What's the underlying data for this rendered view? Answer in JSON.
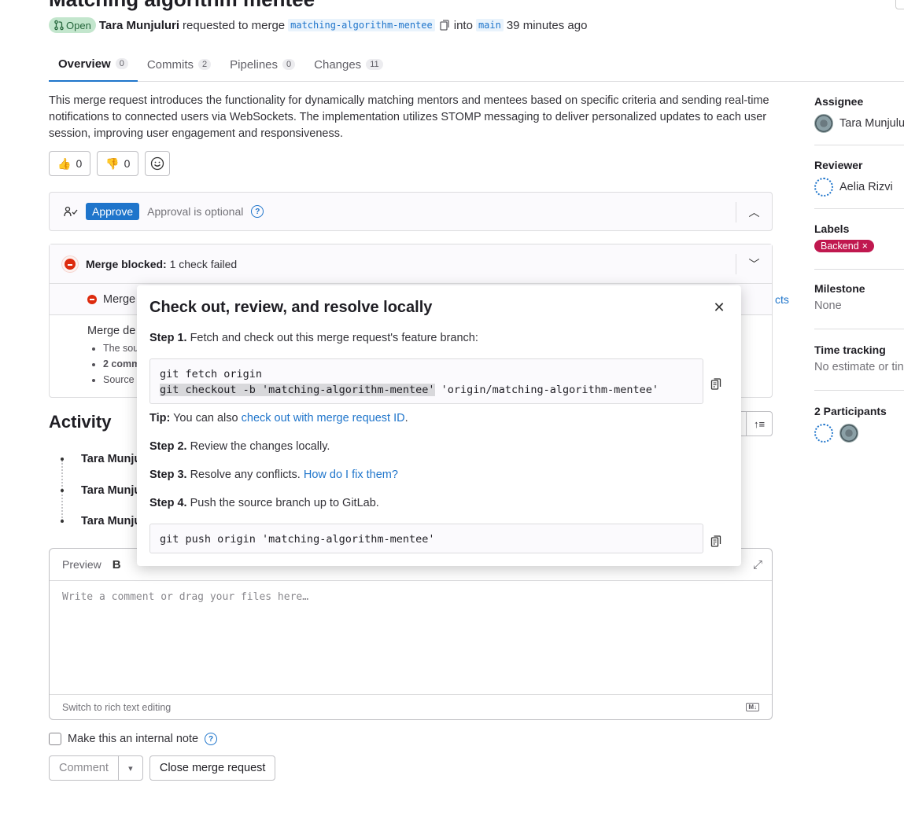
{
  "header": {
    "title": "Matching algorithm mentee",
    "status": "Open",
    "author": "Tara Munjuluri",
    "requested_text": "requested to merge",
    "source_branch": "matching-algorithm-mentee",
    "into_text": "into",
    "target_branch": "main",
    "time_ago": "39 minutes ago"
  },
  "tabs": [
    {
      "label": "Overview",
      "count": "0"
    },
    {
      "label": "Commits",
      "count": "2"
    },
    {
      "label": "Pipelines",
      "count": "0"
    },
    {
      "label": "Changes",
      "count": "11"
    }
  ],
  "description": "This merge request introduces the functionality for dynamically matching mentors and mentees based on specific criteria and sending real-time notifications to connected users via WebSockets. The implementation utilizes STOMP messaging to deliver personalized updates to each user session, improving user engagement and responsiveness.",
  "reactions": {
    "thumbs_up": "0",
    "thumbs_down": "0"
  },
  "approval": {
    "button": "Approve",
    "text": "Approval is optional"
  },
  "merge": {
    "blocked_label": "Merge blocked:",
    "blocked_detail": "1 check failed",
    "row_text": "Merge",
    "row_link_fragment": "cts",
    "details_title": "Merge de",
    "details_items": [
      "The sou",
      "2 comm",
      "Source"
    ]
  },
  "activity": {
    "heading": "Activity",
    "items": [
      "Tara Munju",
      "Tara Munju",
      "Tara Munju"
    ]
  },
  "editor": {
    "preview_tab": "Preview",
    "bold": "B",
    "placeholder": "Write a comment or drag your files here…",
    "footer_link": "Switch to rich text editing",
    "md_badge": "M↓"
  },
  "internal_note": "Make this an internal note",
  "buttons": {
    "comment": "Comment",
    "close_mr": "Close merge request"
  },
  "sidebar": {
    "assignee_title": "Assignee",
    "assignee_name": "Tara Munjulu",
    "reviewer_title": "Reviewer",
    "reviewer_name": "Aelia Rizvi",
    "labels_title": "Labels",
    "label": "Backend",
    "milestone_title": "Milestone",
    "milestone_value": "None",
    "time_title": "Time tracking",
    "time_value": "No estimate or tin",
    "participants_title": "2 Participants"
  },
  "modal": {
    "title": "Check out, review, and resolve locally",
    "step1_label": "Step 1.",
    "step1_text": "Fetch and check out this merge request's feature branch:",
    "code1_line1": "git fetch origin",
    "code1_line2_hl": "git checkout -b 'matching-algorithm-mentee'",
    "code1_line2_rest": " 'origin/matching-algorithm-mentee'",
    "tip_label": "Tip:",
    "tip_text": "You can also",
    "tip_link": "check out with merge request ID",
    "tip_end": ".",
    "step2_label": "Step 2.",
    "step2_text": "Review the changes locally.",
    "step3_label": "Step 3.",
    "step3_text": "Resolve any conflicts.",
    "step3_link": "How do I fix them?",
    "step4_label": "Step 4.",
    "step4_text": "Push the source branch up to GitLab.",
    "code2": "git push origin 'matching-algorithm-mentee'"
  }
}
